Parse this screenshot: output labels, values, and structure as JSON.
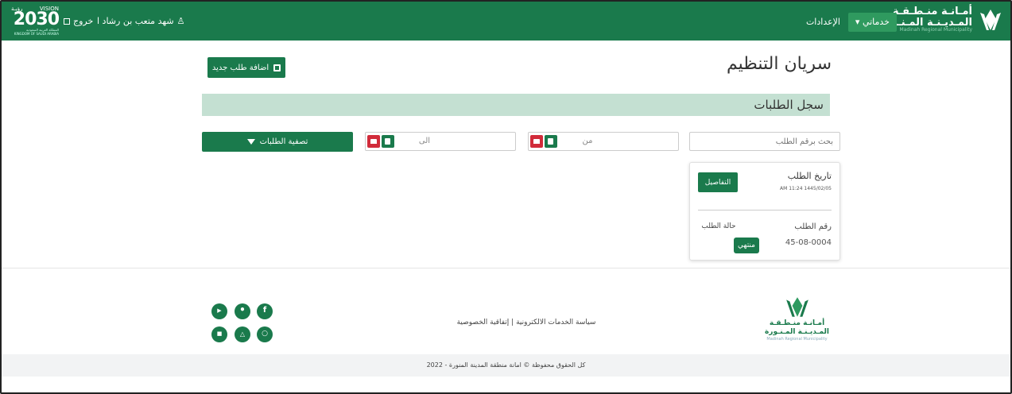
{
  "colors": {
    "primary": "#1a7a4c",
    "section_bg": "#c4e0d2",
    "danger": "#d12b3a"
  },
  "navbar": {
    "logo": {
      "line1": "أمـانـة منـطـقـة",
      "line2": "المـديـنـة المـنـورة",
      "line3": "Madinah Regional Municipality",
      "icon": "madinah-logo-icon"
    },
    "services_label": "خدماتي",
    "settings_label": "الإعدادات",
    "user_name": "شهد متعب بن رشاد ا",
    "logout_label": "خروج",
    "vision": {
      "top_left": "VISION",
      "top_right": "رؤيـة",
      "big": "2030",
      "sub1": "المملكة العربية السعودية",
      "sub2": "KINGDOM OF SAUDI ARABIA"
    }
  },
  "main": {
    "page_title": "سريان التنظيم",
    "add_button_label": "اضافة طلب جديد",
    "section_title": "سجل الطلبات",
    "search": {
      "placeholder": "بحث برقم الطلب"
    },
    "date_from": {
      "label": "من"
    },
    "date_to": {
      "label": "الى"
    },
    "filter_button_label": "تصفية الطلبات"
  },
  "request_card": {
    "date_label": "تاريخ الطلب",
    "date_value": "AM 11:24  1445/02/05",
    "details_button_label": "التفاصيل",
    "number_label": "رقم الطلب",
    "number_value": "45-08-0004",
    "status_label": "حالة الطلب",
    "status_value": "منتهي"
  },
  "footer": {
    "logo": {
      "line1": "أمـانـة منـطـقـة",
      "line2": "المـديـنـة المـنـورة",
      "line3": "Madinah Regional Municipality"
    },
    "links": {
      "policy": "سياسة الخدمات الالكترونية",
      "separator": "|",
      "privacy": "إتفاقية الخصوصية"
    },
    "social": [
      "facebook-icon",
      "twitter-icon",
      "youtube-icon",
      "instagram-icon",
      "snapchat-icon",
      "blackberry-icon"
    ],
    "copyright": "كل الحقوق محفوظة © امانة منطقة المدينة المنورة - 2022"
  }
}
